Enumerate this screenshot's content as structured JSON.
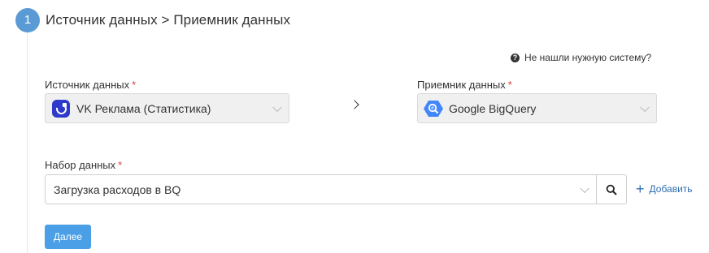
{
  "step": {
    "number": "1",
    "title": "Источник данных > Приемник данных"
  },
  "help_link": "Не нашли нужную систему?",
  "source": {
    "label": "Источник данных",
    "required_mark": "*",
    "value": "VK Реклама (Статистика)",
    "icon": "vk-ads-logo"
  },
  "destination": {
    "label": "Приемник данных",
    "required_mark": "*",
    "value": "Google BigQuery",
    "icon": "bigquery-logo"
  },
  "separator_icon": "chevron-right",
  "dataset": {
    "label": "Набор данных",
    "required_mark": "*",
    "value": "Загрузка расходов в BQ"
  },
  "add_label": "Добавить",
  "next_button": "Далее",
  "colors": {
    "step_circle": "#5b9bd5",
    "primary_button": "#4a9fe6",
    "link": "#2f6fb1",
    "required": "#e03e3e"
  }
}
